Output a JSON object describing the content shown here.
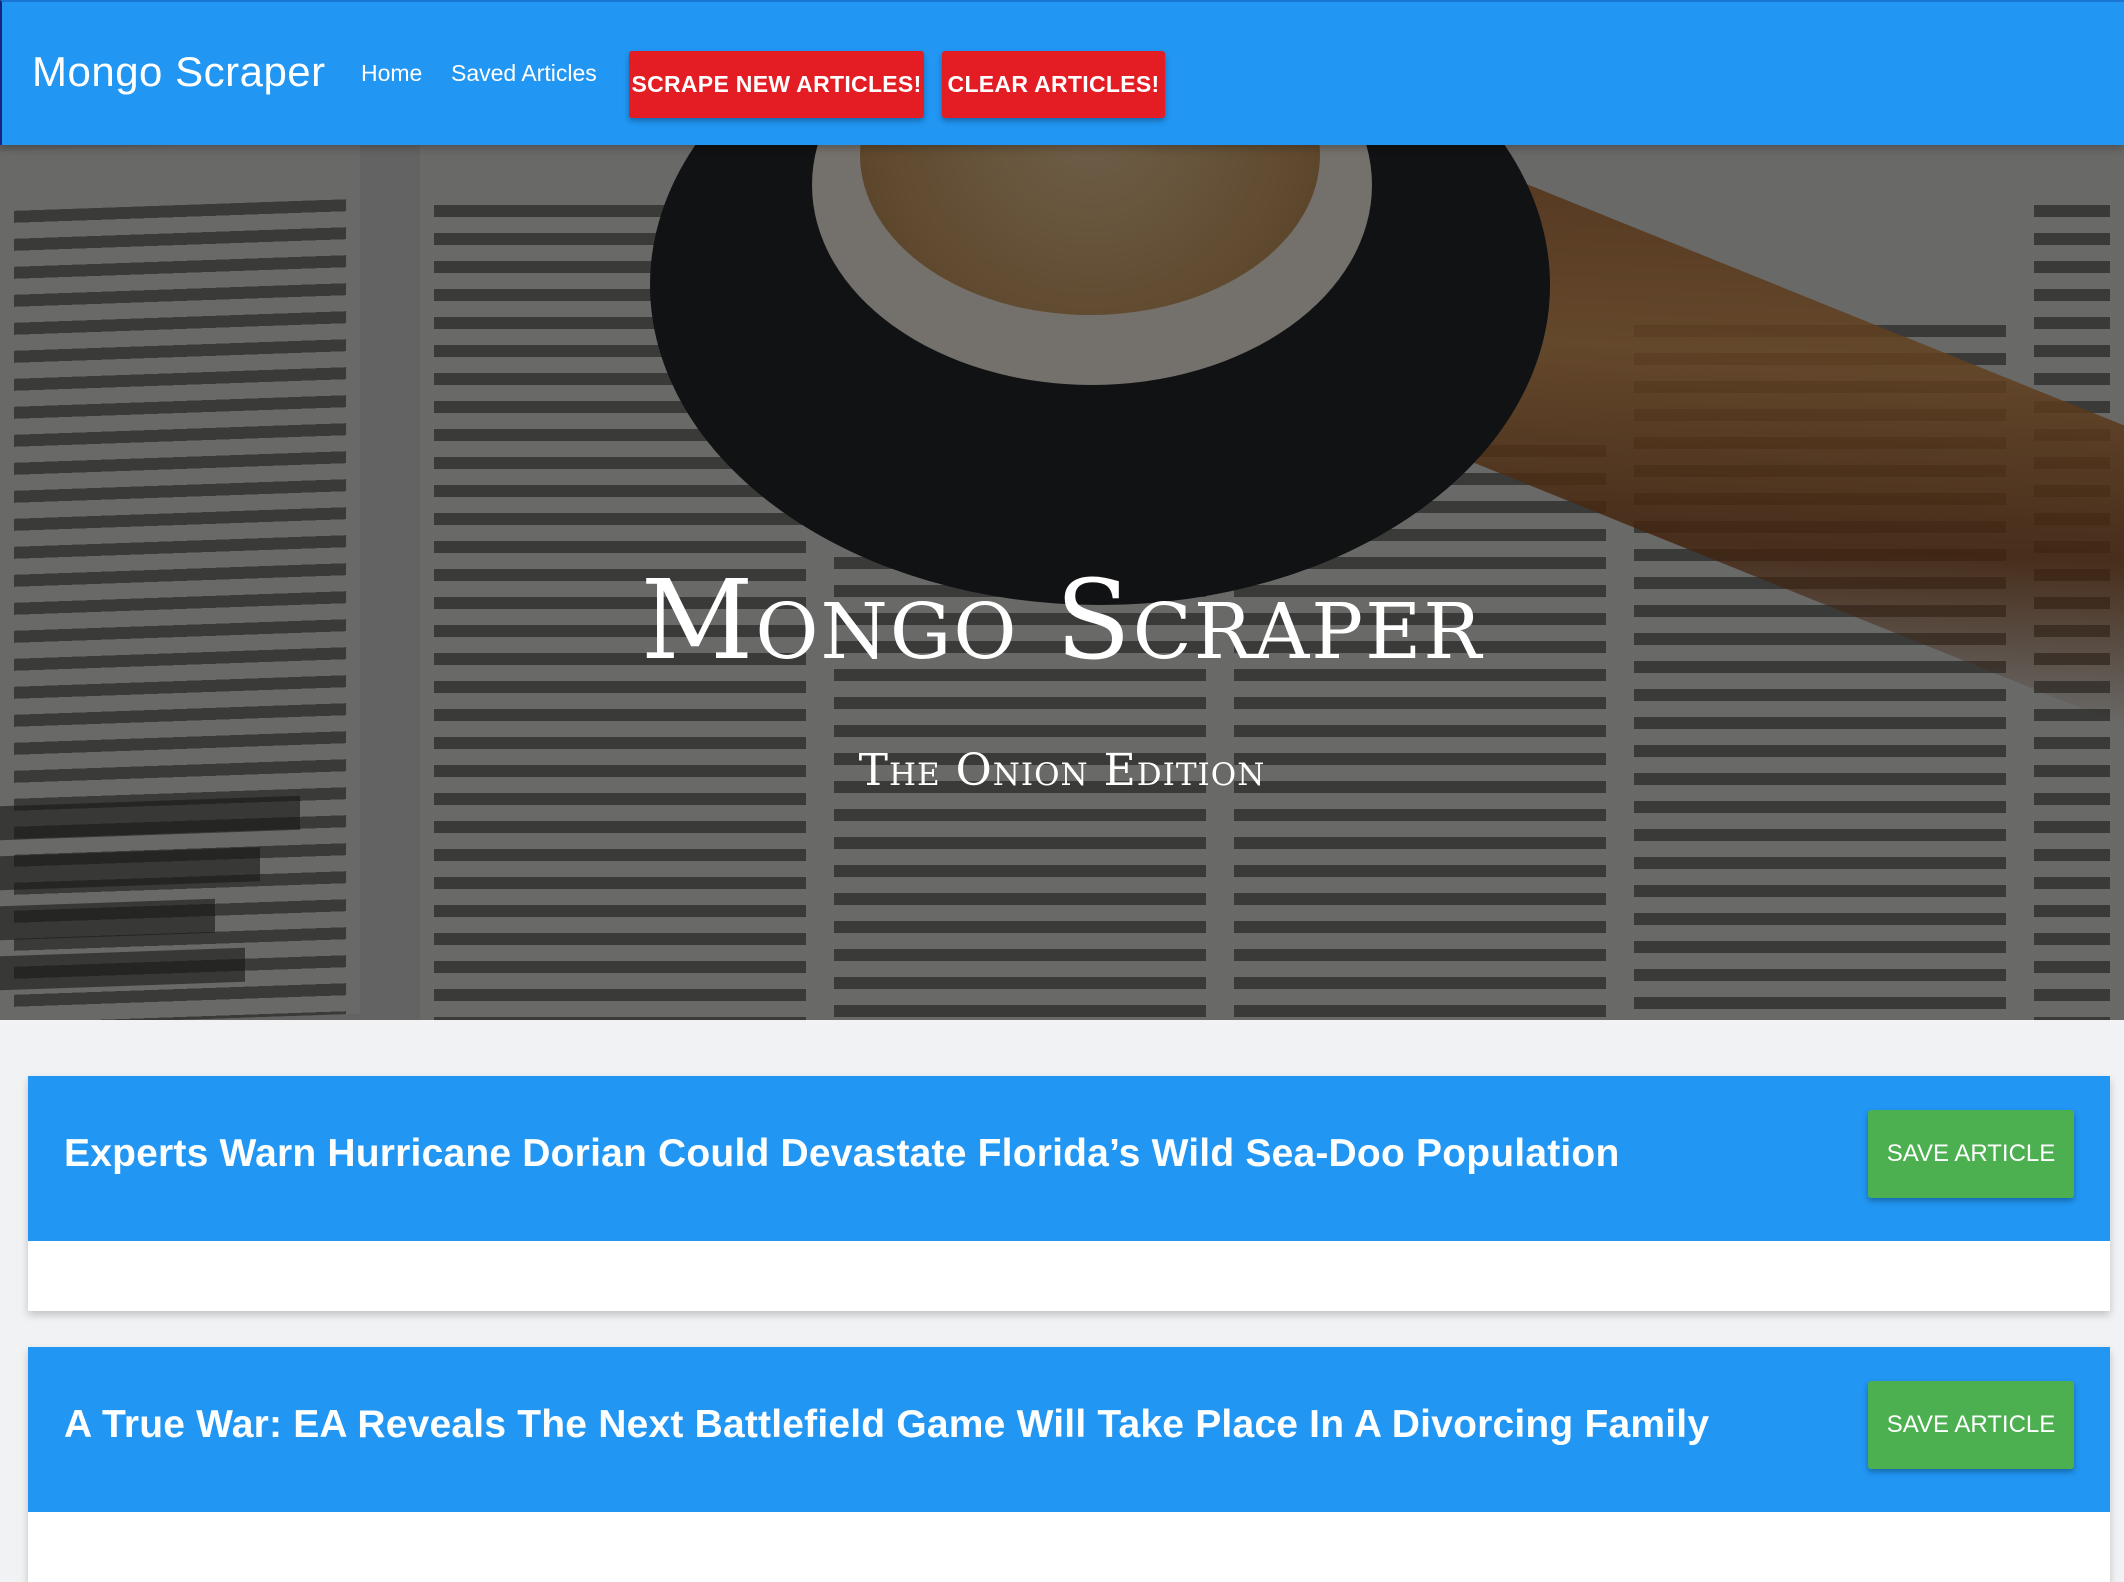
{
  "navbar": {
    "brand": "Mongo Scraper",
    "links": [
      "Home",
      "Saved Articles"
    ],
    "scrape_button": "SCRAPE NEW ARTICLES!",
    "clear_button": "CLEAR ARTICLES!"
  },
  "hero": {
    "title": "Mongo Scraper",
    "subtitle": "The Onion Edition"
  },
  "articles": [
    {
      "title": "Experts Warn Hurricane Dorian Could Devastate Florida’s Wild Sea-Doo Population",
      "save_label": "SAVE ARTICLE"
    },
    {
      "title": "A True War: EA Reveals The Next Battlefield Game Will Take Place In A Divorcing Family",
      "save_label": "SAVE ARTICLE"
    }
  ],
  "colors": {
    "primary": "#2196f3",
    "danger": "#e41c23",
    "success": "#4caf50"
  }
}
